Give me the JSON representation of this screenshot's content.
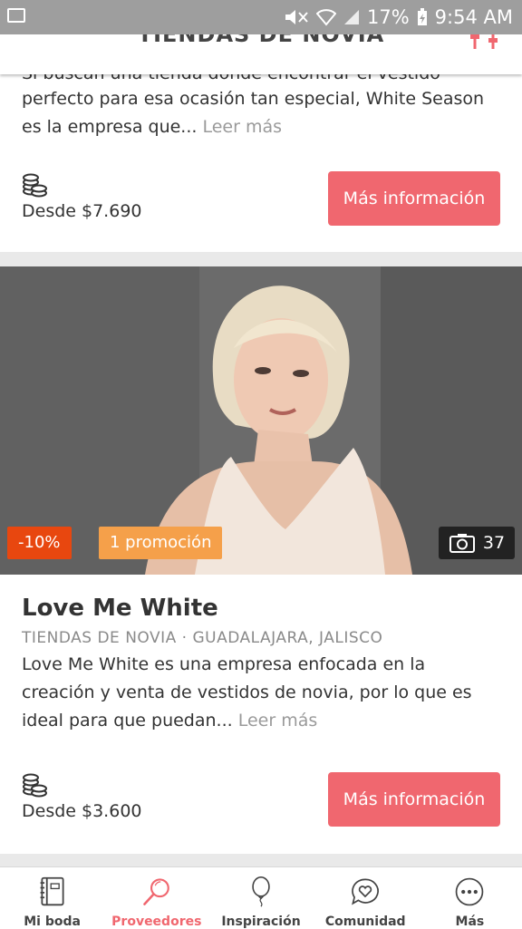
{
  "status_bar": {
    "battery": "17%",
    "time": "9:54 AM"
  },
  "header": {
    "title": "TIENDAS DE NOVIA"
  },
  "listing_top": {
    "description_clipped": "Si buscan una tienda donde encontrar el vestido",
    "description": "perfecto para esa ocasión tan especial, White Season es la empresa que...",
    "read_more": "Leer más",
    "price": "Desde $7.690",
    "button": "Más información"
  },
  "listing_main": {
    "discount_badge": "-10%",
    "promo_badge": "1 promoción",
    "photo_count": "37",
    "name": "Love Me White",
    "meta": "TIENDAS DE NOVIA · GUADALAJARA, JALISCO",
    "description": "Love Me White es una empresa enfocada en la creación y venta de vestidos de novia, por lo que es ideal para que puedan...",
    "read_more": "Leer más",
    "price": "Desde $3.600",
    "button": "Más información"
  },
  "bottom_nav": [
    {
      "label": "Mi boda",
      "icon": "notebook-icon"
    },
    {
      "label": "Proveedores",
      "icon": "search-icon"
    },
    {
      "label": "Inspiración",
      "icon": "balloon-icon"
    },
    {
      "label": "Comunidad",
      "icon": "chat-heart-icon"
    },
    {
      "label": "Más",
      "icon": "more-icon"
    }
  ],
  "colors": {
    "accent": "#f0676f",
    "discount": "#e8470f",
    "promo": "#f5a04a"
  }
}
